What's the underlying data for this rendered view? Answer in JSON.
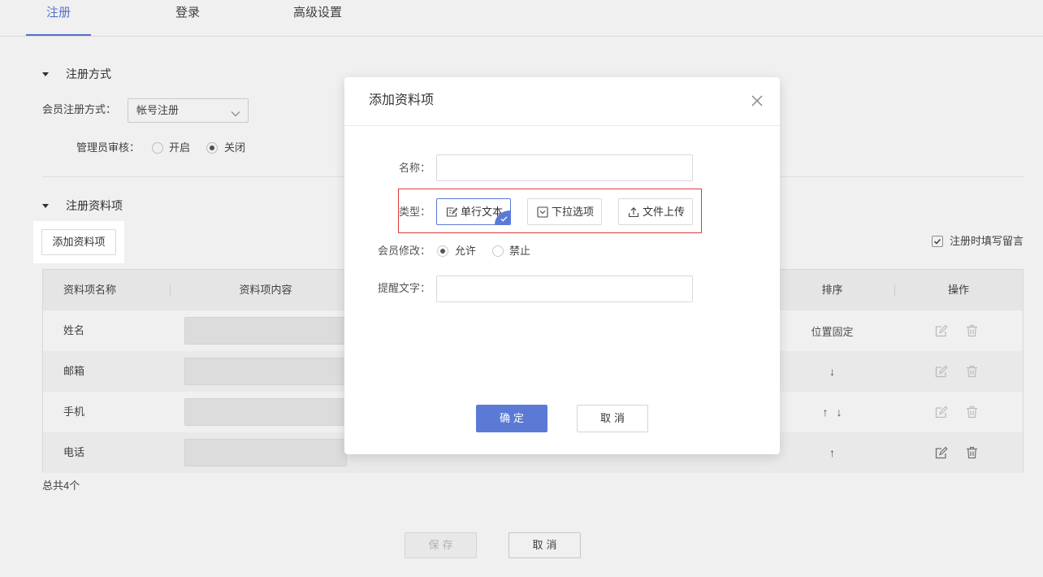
{
  "colors": {
    "accent": "#5b7ad6",
    "highlight_frame": "#e23b3b"
  },
  "tabs": [
    {
      "label": "注册",
      "active": true
    },
    {
      "label": "登录",
      "active": false
    },
    {
      "label": "高级设置",
      "active": false
    }
  ],
  "register_method": {
    "title": "注册方式",
    "method_label": "会员注册方式：",
    "method_value": "帐号注册",
    "audit_label": "管理员审核：",
    "audit_options": [
      {
        "label": "开启",
        "checked": false
      },
      {
        "label": "关闭",
        "checked": true
      }
    ]
  },
  "profile_items": {
    "title": "注册资料项",
    "add_button": "添加资料项",
    "message_option": {
      "label": "注册时填写留言",
      "checked": true
    },
    "columns": {
      "name": "资料项名称",
      "content": "资料项内容",
      "sort": "排序",
      "actions": "操作"
    },
    "rows": [
      {
        "name": "姓名",
        "sort_text": "位置固定",
        "actions_enabled": false
      },
      {
        "name": "邮箱",
        "move_down": "↓",
        "actions_enabled": false
      },
      {
        "name": "手机",
        "move_up": "↑",
        "move_down": "↓",
        "actions_enabled": false
      },
      {
        "name": "电话",
        "move_up": "↑",
        "actions_enabled": true
      }
    ],
    "row_action_icons": [
      "edit-icon",
      "delete-icon"
    ],
    "total": "总共4个"
  },
  "footer": {
    "save": "保存",
    "save_disabled": true,
    "cancel": "取消"
  },
  "modal": {
    "title": "添加资料项",
    "name": {
      "label": "名称：",
      "value": ""
    },
    "type": {
      "label": "类型：",
      "options": [
        {
          "label": "单行文本",
          "icon": "text-line-icon",
          "selected": true
        },
        {
          "label": "下拉选项",
          "icon": "dropdown-icon",
          "selected": false
        },
        {
          "label": "文件上传",
          "icon": "upload-icon",
          "selected": false
        }
      ]
    },
    "member_edit": {
      "label": "会员修改：",
      "options": [
        {
          "label": "允许",
          "checked": true
        },
        {
          "label": "禁止",
          "checked": false
        }
      ]
    },
    "hint": {
      "label": "提醒文字：",
      "value": ""
    },
    "confirm": "确定",
    "cancel": "取消"
  }
}
